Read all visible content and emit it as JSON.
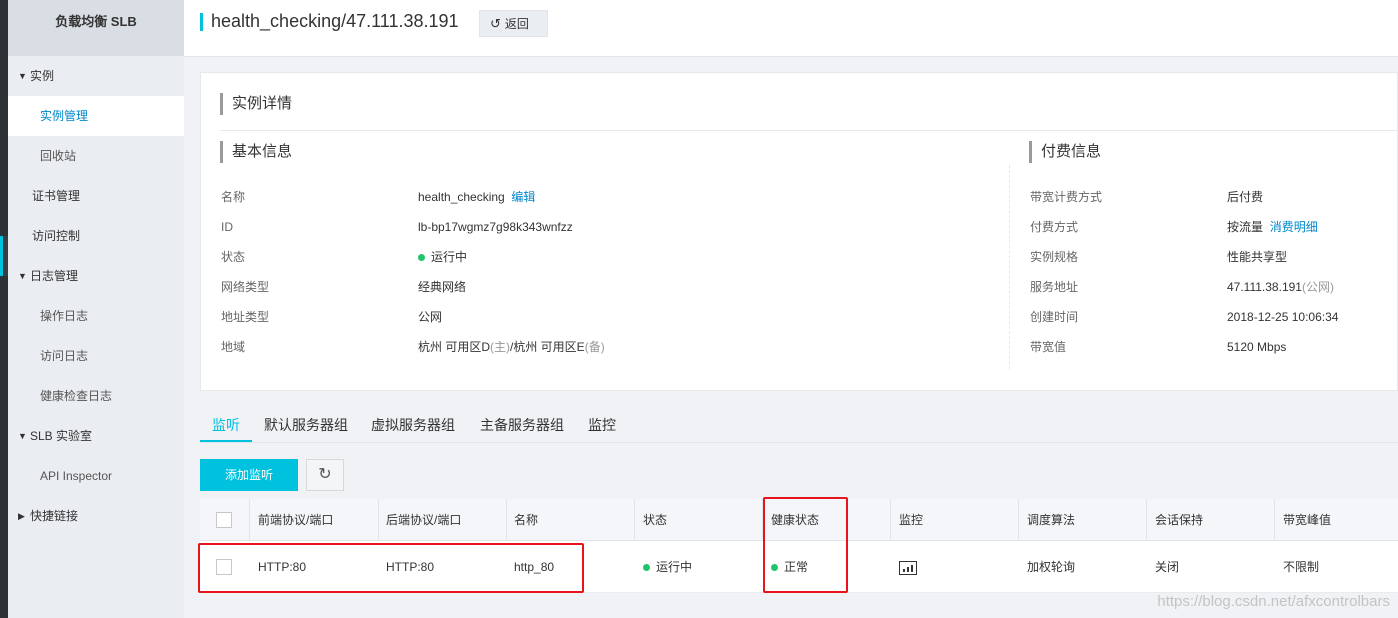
{
  "sidebar": {
    "title": "负载均衡 SLB",
    "items": [
      {
        "label": "实例",
        "type": "group",
        "caret": "▼"
      },
      {
        "label": "实例管理",
        "type": "sub",
        "active": true
      },
      {
        "label": "回收站",
        "type": "sub"
      },
      {
        "label": "证书管理",
        "type": "top"
      },
      {
        "label": "访问控制",
        "type": "top"
      },
      {
        "label": "日志管理",
        "type": "group",
        "caret": "▼"
      },
      {
        "label": "操作日志",
        "type": "sub"
      },
      {
        "label": "访问日志",
        "type": "sub"
      },
      {
        "label": "健康检查日志",
        "type": "sub"
      },
      {
        "label": "SLB 实验室",
        "type": "group",
        "caret": "▼"
      },
      {
        "label": "API Inspector",
        "type": "sub"
      },
      {
        "label": "快捷链接",
        "type": "group",
        "caret": "▶"
      }
    ]
  },
  "header": {
    "title": "health_checking/47.111.38.191",
    "back_label": "返回"
  },
  "detail": {
    "section_title": "实例详情",
    "basic": {
      "title": "基本信息",
      "name_label": "名称",
      "name_value": "health_checking",
      "edit_link": "编辑",
      "id_label": "ID",
      "id_value": "lb-bp17wgmz7g98k343wnfzz",
      "status_label": "状态",
      "status_value": "运行中",
      "network_label": "网络类型",
      "network_value": "经典网络",
      "address_type_label": "地址类型",
      "address_type_value": "公网",
      "region_label": "地域",
      "region_main": "杭州 可用区D",
      "region_main_tag": "(主)",
      "region_sep": "/杭州 可用区E",
      "region_backup_tag": "(备)"
    },
    "billing": {
      "title": "付费信息",
      "bw_billing_label": "带宽计费方式",
      "bw_billing_value": "后付费",
      "pay_label": "付费方式",
      "pay_value": "按流量",
      "pay_link": "消费明细",
      "spec_label": "实例规格",
      "spec_value": "性能共享型",
      "addr_label": "服务地址",
      "addr_value": "47.111.38.191",
      "addr_tag": "(公网)",
      "created_label": "创建时间",
      "created_value": "2018-12-25 10:06:34",
      "bw_label": "带宽值",
      "bw_value": "5120 Mbps"
    }
  },
  "tabs": [
    "监听",
    "默认服务器组",
    "虚拟服务器组",
    "主备服务器组",
    "监控"
  ],
  "actions": {
    "add_listener": "添加监听",
    "refresh_icon": "refresh-icon"
  },
  "table": {
    "headers": [
      "前端协议/端口",
      "后端协议/端口",
      "名称",
      "状态",
      "健康状态",
      "监控",
      "调度算法",
      "会话保持",
      "带宽峰值"
    ],
    "rows": [
      {
        "front": "HTTP:80",
        "back": "HTTP:80",
        "name": "http_80",
        "status": "运行中",
        "health": "正常",
        "monitor_icon": "bar-chart-icon",
        "algo": "加权轮询",
        "session": "关闭",
        "peak": "不限制"
      }
    ]
  },
  "watermark": "https://blog.csdn.net/afxcontrolbars",
  "colors": {
    "accent": "#00c1de",
    "link": "#0088cc",
    "ok": "#1ec56b",
    "highlight": "#e8141c"
  }
}
